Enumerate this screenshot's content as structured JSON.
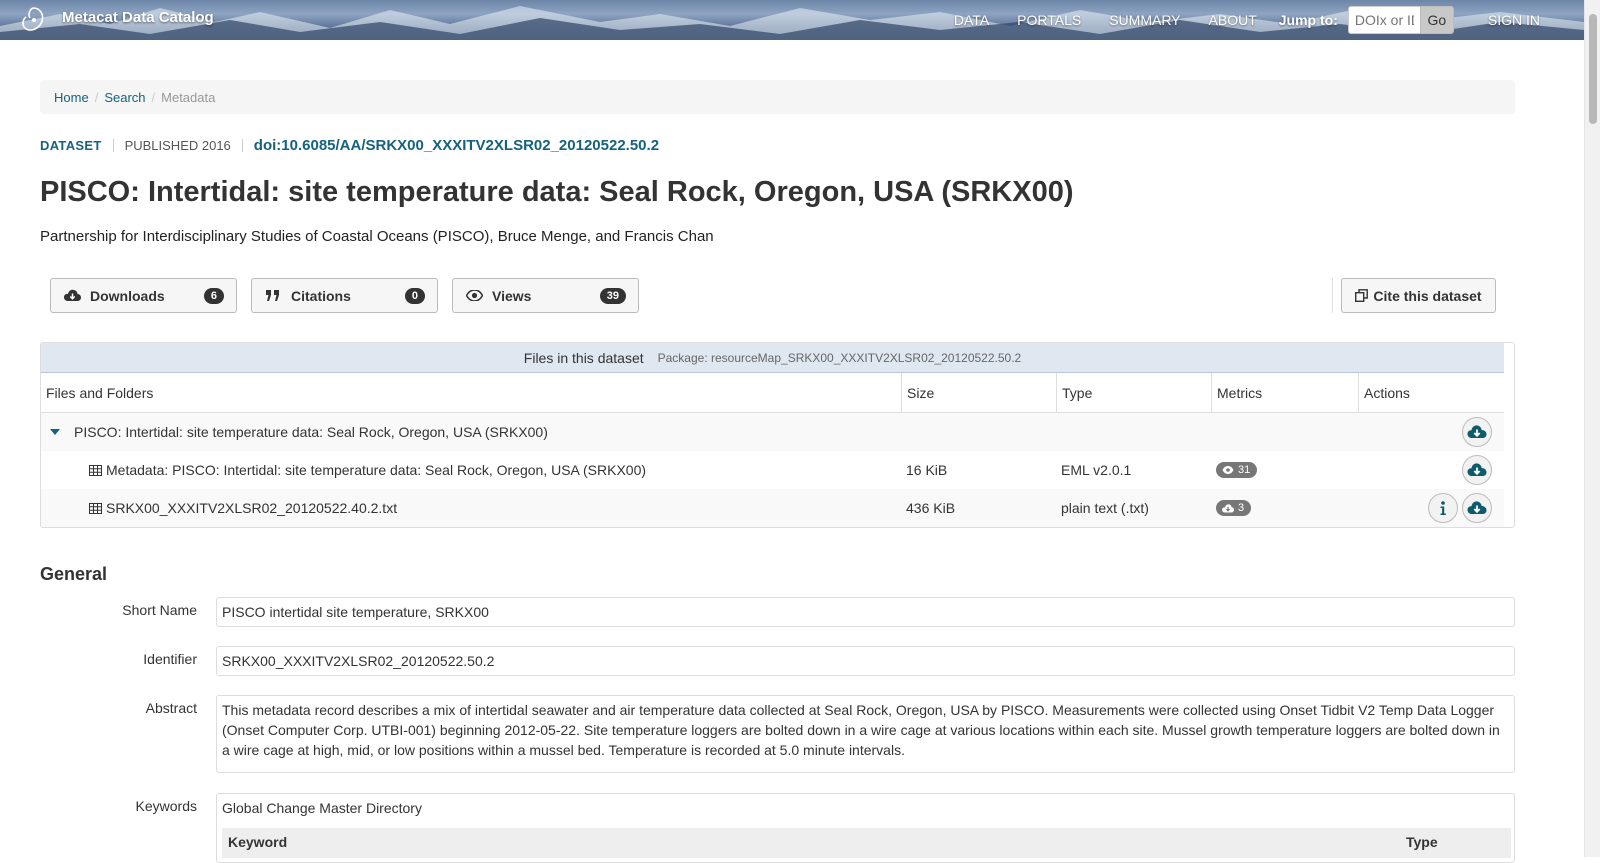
{
  "nav": {
    "brand": "Metacat Data Catalog",
    "links": [
      "DATA",
      "PORTALS",
      "SUMMARY",
      "ABOUT"
    ],
    "jump_label": "Jump to:",
    "jump_placeholder": "DOIx or ID",
    "go_label": "Go",
    "signin_label": "SIGN IN"
  },
  "breadcrumb": {
    "home": "Home",
    "search": "Search",
    "current": "Metadata"
  },
  "header": {
    "type": "DATASET",
    "published": "PUBLISHED 2016",
    "doi": "doi:10.6085/AA/SRKX00_XXXITV2XLSR02_20120522.50.2",
    "title": "PISCO: Intertidal: site temperature data: Seal Rock, Oregon, USA (SRKX00)",
    "authors": "Partnership for Interdisciplinary Studies of Coastal Oceans (PISCO), Bruce Menge, and Francis Chan"
  },
  "metrics": {
    "downloads_label": "Downloads",
    "downloads_count": "6",
    "citations_label": "Citations",
    "citations_count": "0",
    "views_label": "Views",
    "views_count": "39",
    "cite_label": "Cite this dataset"
  },
  "files": {
    "title": "Files in this dataset",
    "package": "Package: resourceMap_SRKX00_XXXITV2XLSR02_20120522.50.2",
    "columns": [
      "Files and Folders",
      "Size",
      "Type",
      "Metrics",
      "Actions"
    ],
    "folder": "PISCO: Intertidal: site temperature data: Seal Rock, Oregon, USA (SRKX00)",
    "rows": [
      {
        "name": "Metadata: PISCO: Intertidal: site temperature data: Seal Rock, Oregon, USA (SRKX00)",
        "size": "16 KiB",
        "type": "EML v2.0.1",
        "metric": "31",
        "metric_icon": "eye-icon"
      },
      {
        "name": "SRKX00_XXXITV2XLSR02_20120522.40.2.txt",
        "size": "436 KiB",
        "type": "plain text (.txt)",
        "metric": "3",
        "metric_icon": "cloud-download-icon"
      }
    ]
  },
  "general": {
    "heading": "General",
    "short_name_label": "Short Name",
    "short_name": "PISCO intertidal site temperature, SRKX00",
    "identifier_label": "Identifier",
    "identifier": "SRKX00_XXXITV2XLSR02_20120522.50.2",
    "abstract_label": "Abstract",
    "abstract": "This metadata record describes a mix of intertidal seawater and air temperature data collected at Seal Rock, Oregon, USA by PISCO. Measurements were collected using Onset Tidbit V2 Temp Data Logger (Onset Computer Corp. UTBI-001) beginning 2012-05-22. Site temperature loggers are bolted down in a wire cage at various locations within each site. Mussel growth temperature loggers are bolted down in a wire cage at high, mid, or low positions within a mussel bed. Temperature is recorded at 5.0 minute intervals.",
    "keywords_label": "Keywords",
    "keywords_vocab": "Global Change Master Directory",
    "keywords_col_keyword": "Keyword",
    "keywords_col_type": "Type"
  },
  "colors": {
    "link": "#15627f",
    "badge_dark": "#333333",
    "badge_gray": "#777777",
    "files_header": "#dfe8f1"
  }
}
